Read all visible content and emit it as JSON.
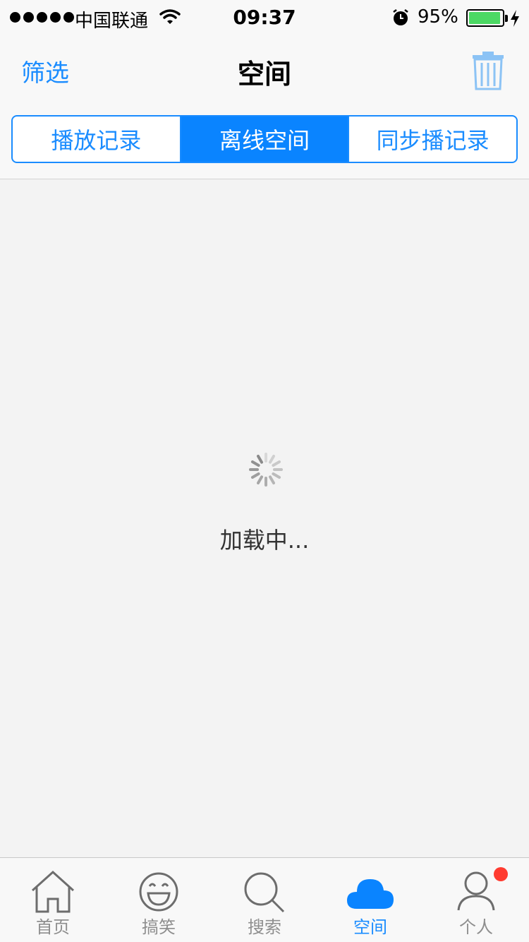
{
  "status_bar": {
    "carrier": "中国联通",
    "time": "09:37",
    "battery_percent": "95%",
    "battery_level": 0.95
  },
  "nav": {
    "left_button": "筛选",
    "title": "空间"
  },
  "segments": [
    {
      "label": "播放记录",
      "active": false
    },
    {
      "label": "离线空间",
      "active": true
    },
    {
      "label": "同步播记录",
      "active": false
    }
  ],
  "content": {
    "loading_text": "加载中..."
  },
  "tabs": [
    {
      "label": "首页",
      "icon": "home-icon",
      "active": false
    },
    {
      "label": "搞笑",
      "icon": "smile-icon",
      "active": false
    },
    {
      "label": "搜索",
      "icon": "search-icon",
      "active": false
    },
    {
      "label": "空间",
      "icon": "cloud-icon",
      "active": true
    },
    {
      "label": "个人",
      "icon": "person-icon",
      "active": false,
      "badge": true
    }
  ],
  "colors": {
    "accent": "#1a8cff",
    "segment_active": "#0a84ff",
    "badge": "#ff3b30",
    "battery": "#4cd964"
  }
}
